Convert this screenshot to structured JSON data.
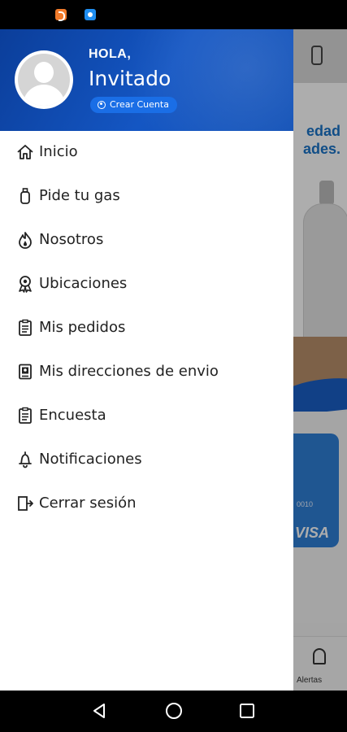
{
  "status_bar": {
    "icons": [
      "app-notification-icon",
      "app-notification-icon"
    ]
  },
  "drawer": {
    "greeting": "HOLA,",
    "user_name": "Invitado",
    "create_account_label": "Crear Cuenta",
    "menu_items": [
      {
        "label": "Inicio",
        "icon": "home-icon"
      },
      {
        "label": "Pide tu gas",
        "icon": "gas-cylinder-icon"
      },
      {
        "label": "Nosotros",
        "icon": "flame-icon"
      },
      {
        "label": "Ubicaciones",
        "icon": "location-badge-icon"
      },
      {
        "label": "Mis pedidos",
        "icon": "clipboard-icon"
      },
      {
        "label": "Mis direcciones de envio",
        "icon": "address-book-icon"
      },
      {
        "label": "Encuesta",
        "icon": "survey-icon"
      },
      {
        "label": "Notificaciones",
        "icon": "bell-icon"
      },
      {
        "label": "Cerrar sesión",
        "icon": "logout-icon"
      }
    ]
  },
  "background_app": {
    "banner_text_line1": "edad",
    "banner_text_line2": "ades.",
    "card_number": "0010",
    "card_brand": "VISA",
    "bottom_tab_label": "Alertas"
  },
  "colors": {
    "header_blue": "#1456c3",
    "button_blue": "#1a6ee6",
    "text_dark": "#222222"
  },
  "navigation_bar": {
    "buttons": [
      "back-icon",
      "home-circle-icon",
      "recents-icon"
    ]
  }
}
